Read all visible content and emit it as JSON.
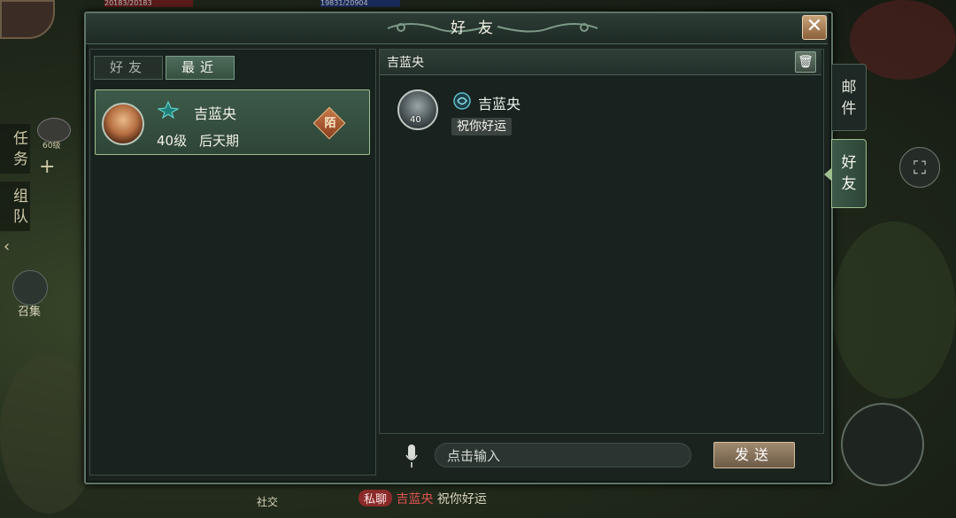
{
  "window": {
    "title": "好友",
    "close_label": "✕"
  },
  "tabs": [
    {
      "label": "好友",
      "active": false
    },
    {
      "label": "最近",
      "active": true
    }
  ],
  "contact": {
    "name": "吉蓝央",
    "level": "40级",
    "realm": "后天期",
    "badge": "陌"
  },
  "chat": {
    "header_name": "吉蓝央",
    "message": {
      "sender": "吉蓝央",
      "avatar_level": "40",
      "text": "祝你好运"
    },
    "input_placeholder": "点击输入",
    "send_label": "发送"
  },
  "side_tabs": [
    {
      "label": "邮件"
    },
    {
      "label": "好友",
      "active": true
    }
  ],
  "background": {
    "left_tabs": [
      "任务",
      "组队"
    ],
    "summon_label": "召集",
    "social_label": "社交",
    "avatar_level": "60级",
    "top_values": [
      "20183/20183",
      "19831/20904"
    ],
    "bottom_chat": {
      "channel": "私聊",
      "sender": "吉蓝央",
      "text": "祝你好运"
    }
  },
  "colors": {
    "accent_green": "#9fbf8f",
    "name_cyan": "#eaf2ec",
    "send_btn": "#8a745b"
  }
}
